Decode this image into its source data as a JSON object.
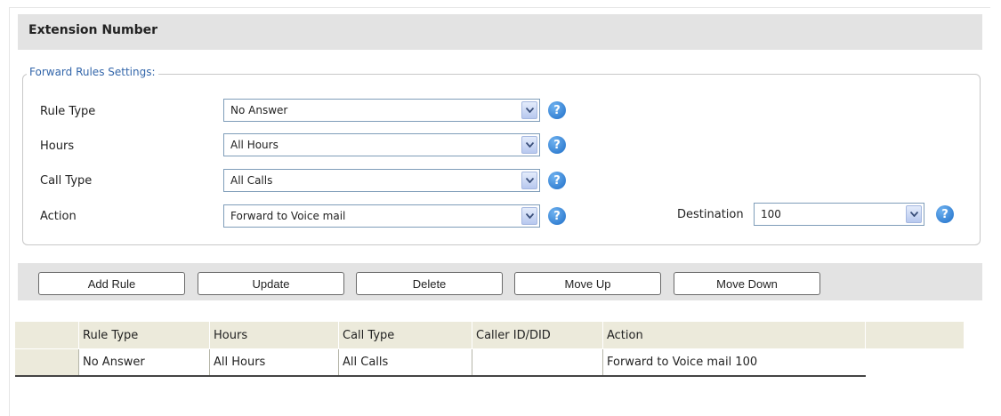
{
  "header": {
    "title": "Extension Number"
  },
  "fieldset": {
    "legend": "Forward Rules Settings:"
  },
  "form": {
    "rule_type": {
      "label": "Rule Type",
      "value": "No Answer"
    },
    "hours": {
      "label": "Hours",
      "value": "All Hours"
    },
    "call_type": {
      "label": "Call Type",
      "value": "All Calls"
    },
    "action": {
      "label": "Action",
      "value": "Forward to Voice mail"
    },
    "destination": {
      "label": "Destination",
      "value": "100"
    },
    "help_glyph": "?"
  },
  "buttons": {
    "add_rule": "Add Rule",
    "update": "Update",
    "delete": "Delete",
    "move_up": "Move Up",
    "move_down": "Move Down"
  },
  "table": {
    "headers": [
      "Rule Type",
      "Hours",
      "Call Type",
      "Caller ID/DID",
      "Action"
    ],
    "rows": [
      [
        "No Answer",
        "All Hours",
        "All Calls",
        "",
        "Forward to Voice mail 100"
      ]
    ]
  },
  "colors": {
    "header_bg": "#e3e3e3",
    "legend_text": "#3366aa",
    "grid_header_bg": "#eceadb",
    "help_icon": "#1f6fc8"
  }
}
